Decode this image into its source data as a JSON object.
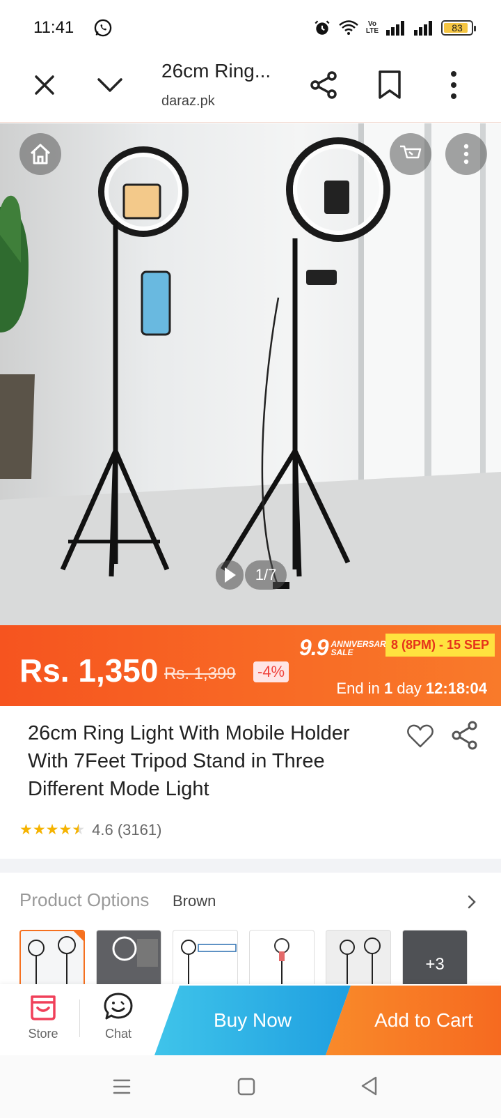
{
  "status_bar": {
    "time": "11:41",
    "volte_line1": "Vo",
    "volte_line2": "LTE",
    "battery": "83"
  },
  "browser": {
    "title": "26cm Ring...",
    "domain": "daraz.pk"
  },
  "gallery": {
    "counter": "1/7"
  },
  "price": {
    "current": "Rs. 1,350",
    "original": "Rs. 1,399",
    "discount": "-4%"
  },
  "sale": {
    "logo_big": "9.9",
    "logo_small_1": "ANNIVERSARY",
    "logo_small_2": "SALE",
    "dates": "8 (8PM) - 15 SEP",
    "ends_prefix": "End in",
    "ends_days": "1",
    "ends_unit": "day",
    "ends_time": "12:18:04"
  },
  "product": {
    "title": "26cm Ring Light With Mobile Holder With 7Feet Tripod Stand in Three Different Mode Light",
    "rating": "4.6",
    "review_count": "(3161)",
    "stars": 4.5
  },
  "options": {
    "label": "Product Options",
    "value": "Brown",
    "more_count": "+3"
  },
  "actions": {
    "store": "Store",
    "chat": "Chat",
    "buy_now": "Buy Now",
    "add_to_cart": "Add to Cart"
  },
  "colors": {
    "brand_orange": "#f6541f",
    "buy_blue": "#1f9fe0",
    "store_pink": "#f0405a",
    "sale_yellow": "#ffe23f"
  }
}
